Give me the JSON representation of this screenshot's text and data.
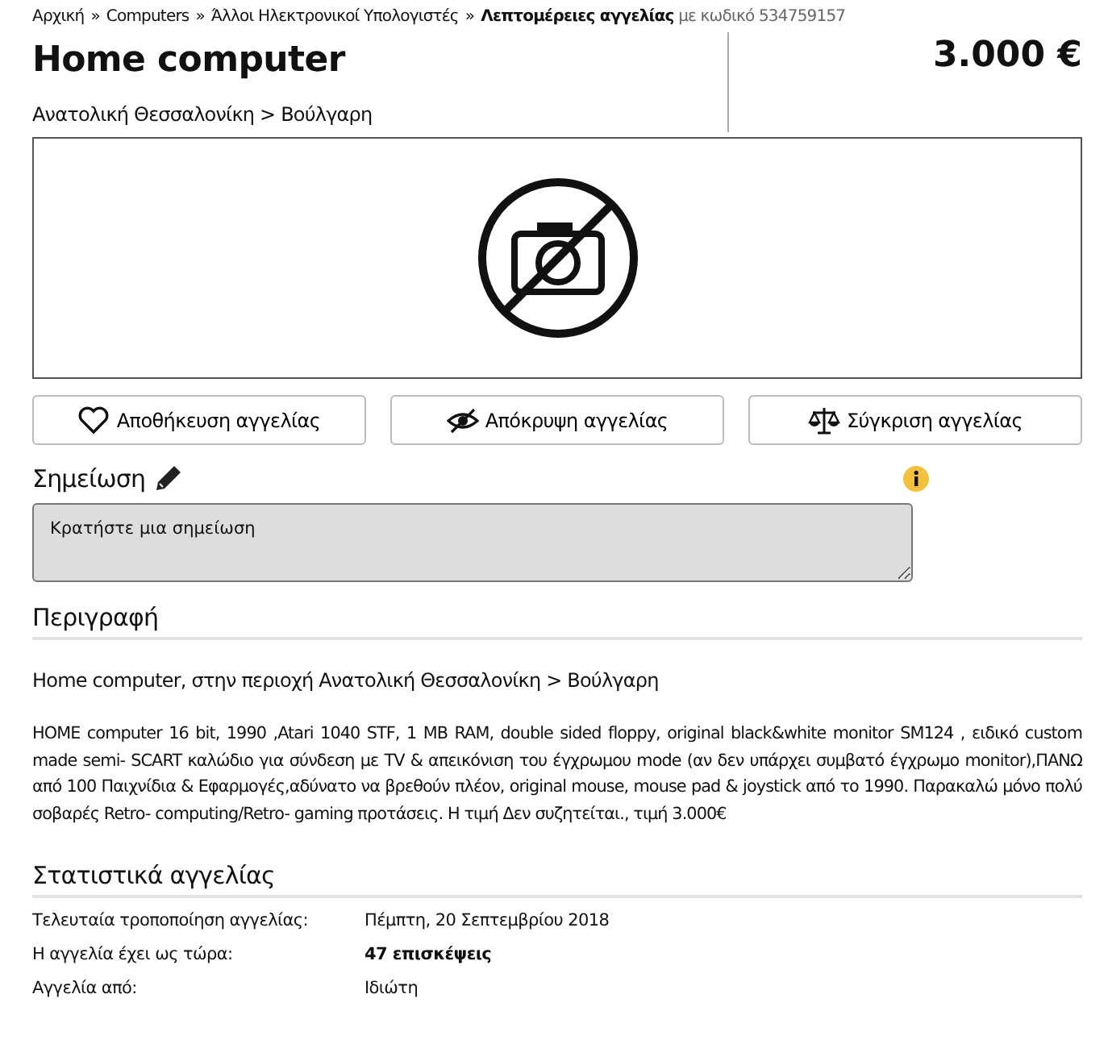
{
  "breadcrumb": {
    "separator": "»",
    "items": [
      {
        "text": "Αρχική",
        "current": false
      },
      {
        "text": "Computers",
        "current": false
      },
      {
        "text": "Άλλοι Ηλεκτρονικοί Υπολογιστές",
        "current": false
      },
      {
        "text": "Λεπτομέρειες αγγελίας",
        "current": true
      }
    ],
    "code": "με κωδικό 534759157"
  },
  "title": "Home computer",
  "location": "Ανατολική Θεσσαλονίκη > Βούλγαρη",
  "price": "3.000 €",
  "photo": {
    "kind": "no-photo"
  },
  "actions": [
    {
      "kind": "save",
      "label": "Αποθήκευση αγγελίας"
    },
    {
      "kind": "hide",
      "label": "Απόκρυψη αγγελίας"
    },
    {
      "kind": "compare",
      "label": "Σύγκριση αγγελίας"
    }
  ],
  "note": {
    "title": "Σημείωση",
    "placeholder": "Κρατήστε μια σημείωση"
  },
  "description": {
    "title": "Περιγραφή",
    "subtitle": "Home computer, στην περιοχή Ανατολική Θεσσαλονίκη > Βούλγαρη",
    "text": "HOME computer 16 bit, 1990 ,Atari 1040 STF, 1 MB RAM, double sided floppy, original black&white monitor SM124 , ειδικό custom made semi- SCART καλώδιο για σύνδεση με TV & απεικόνιση του έγχρωμου mode (αν δεν υπάρχει συμβατό έγχρωμο monitor),ΠΑΝΩ από 100 Παιχνίδια & Εφαρμογές,αδύνατο να βρεθούν πλέον, original mouse, mouse pad & joystick από το 1990. Παρακαλώ μόνο πολύ σοβαρές Retro- computing/Retro- gaming προτάσεις. Η τιμή Δεν συζητείται., τιμή 3.000€"
  },
  "stats": {
    "title": "Στατιστικά αγγελίας",
    "rows": [
      {
        "label": "Τελευταία τροποποίηση αγγελίας:",
        "value": "Πέμπτη, 20 Σεπτεμβρίου 2018",
        "bold": false
      },
      {
        "label": "Η αγγελία έχει ως τώρα:",
        "value": "47 επισκέψεις",
        "bold": true
      },
      {
        "label": "Αγγελία από:",
        "value": "Ιδιώτη",
        "bold": false
      }
    ]
  }
}
